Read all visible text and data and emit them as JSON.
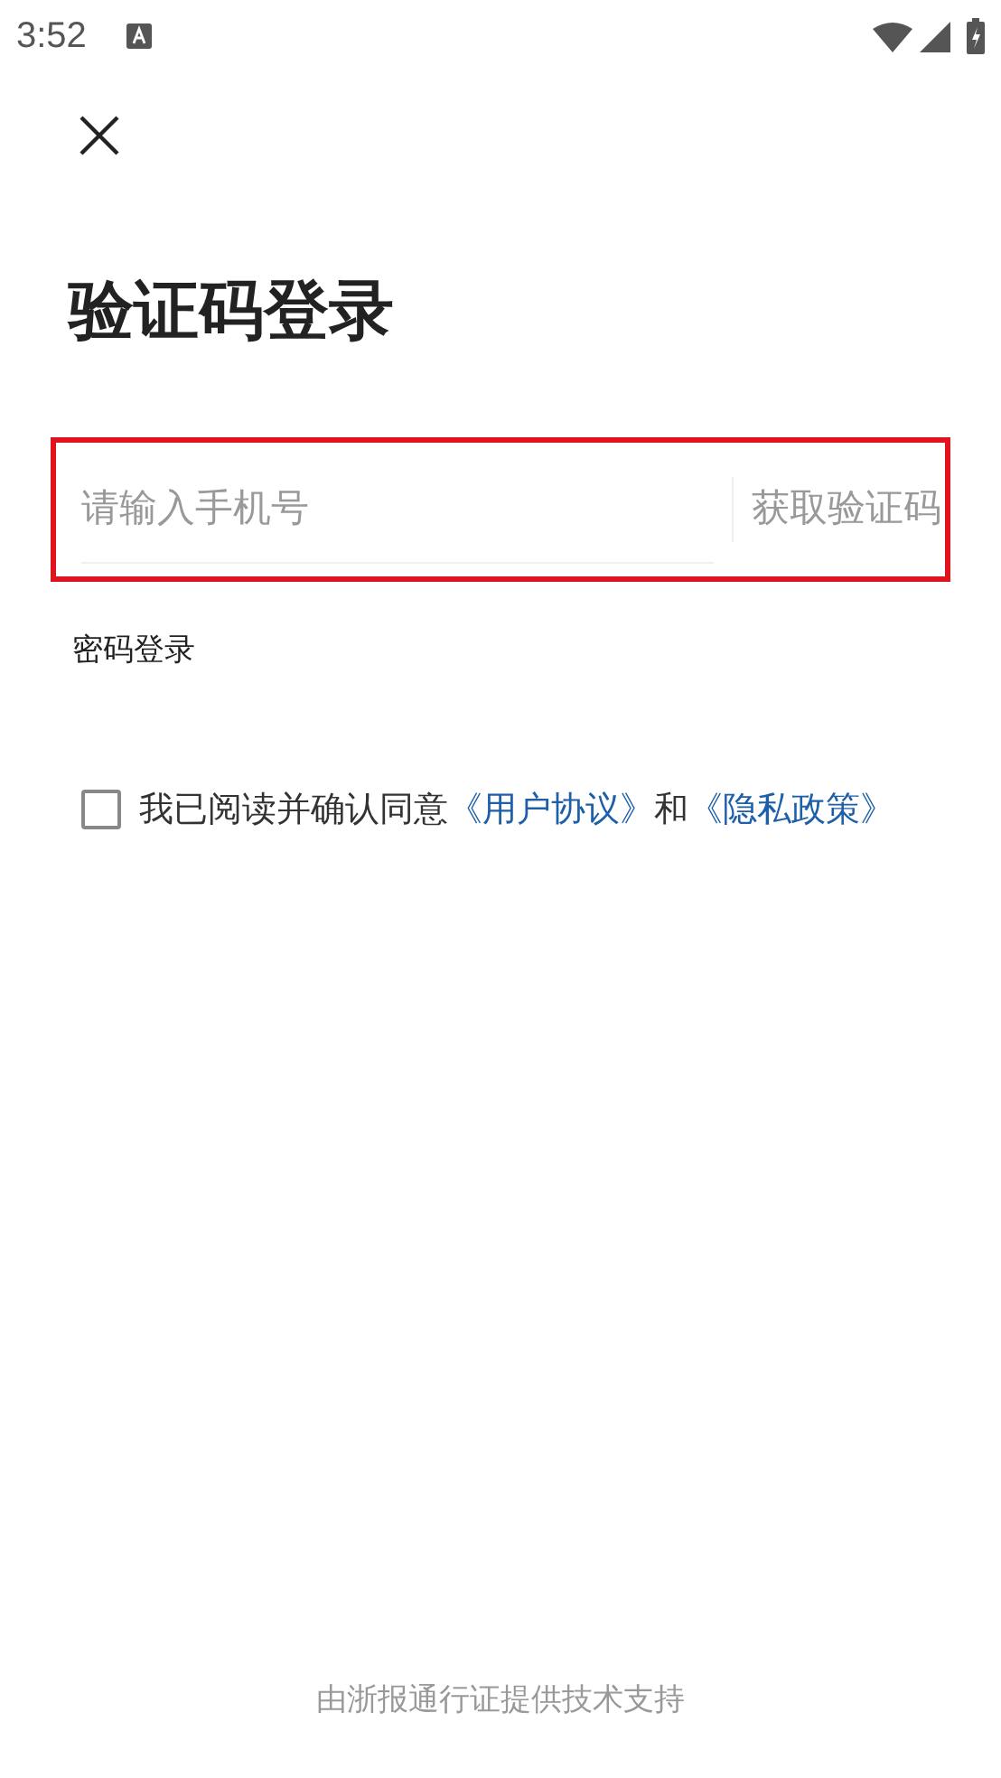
{
  "status_bar": {
    "time": "3:52"
  },
  "title": "验证码登录",
  "phone_form": {
    "highlighted": true,
    "placeholder": "请输入手机号",
    "code_button": "获取验证码"
  },
  "password_login_link": "密码登录",
  "agreement": {
    "checked": false,
    "text_before": "我已阅读并确认同意",
    "link_1": "《用户协议》",
    "text_middle": "和",
    "link_2": "《隐私政策》"
  },
  "footer": "由浙报通行证提供技术支持"
}
